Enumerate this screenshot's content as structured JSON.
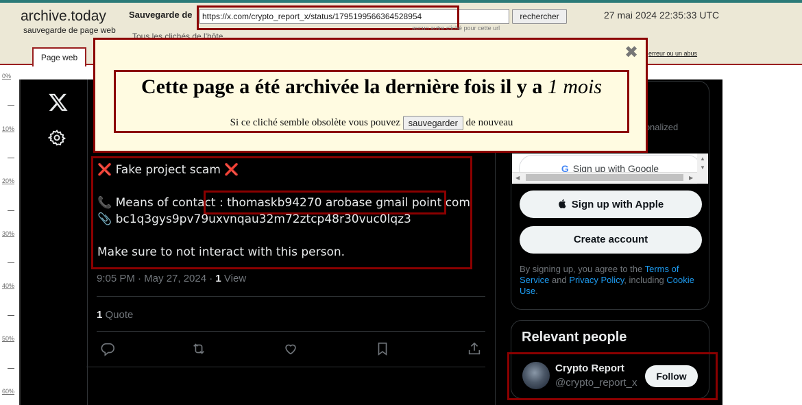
{
  "archive": {
    "brand": "archive.today",
    "brand_sub": "sauvegarde de page web",
    "save_label": "Sauvegarde de",
    "url": "https://x.com/crypto_report_x/status/1795199566364528954",
    "search_button": "rechercher",
    "no_other_snapshot": "aucun autre cliché pour cette url",
    "datetime": "27 mai 2024 22:35:33 UTC",
    "header_hint": "Tous les clichés de l'hôte",
    "report_link": "erreur ou un abus",
    "tab_label": "Page web"
  },
  "ruler": [
    "0%",
    "10%",
    "20%",
    "30%",
    "40%",
    "50%",
    "60%"
  ],
  "popup": {
    "title_main": "Cette page a été archivée la dernière fois il y a",
    "title_age": "1 mois",
    "line_before": "Si ce cliché semble obsolète vous pouvez",
    "button": "sauvegarder",
    "line_after": "de nouveau",
    "close_glyph": "✖"
  },
  "tweet": {
    "line1_cross": "❌",
    "line1_text": "Fake project scam",
    "line2_phone_icon": "📞",
    "line2_text": "Means of contact : thomaskb94270 arobase gmail point com",
    "line3_clip_icon": "📎",
    "line3_text": "bc1q3gys9pv79uxvnqau32m72ztcp48r30vuc0lqz3",
    "line4_text": "Make sure to not interact with this person.",
    "meta_time": "9:05 PM · May 27, 2024 · ",
    "views_count": "1",
    "views_label": " View",
    "quotes_count": "1",
    "quotes_label": " Quote"
  },
  "sidebar": {
    "personalized": "rsonalized",
    "google_button": "Sign up with Google",
    "apple_button": "Sign up with Apple",
    "create_account": "Create account",
    "terms_prefix": "By signing up, you agree to the ",
    "terms_link": "Terms of Service",
    "terms_and": " and ",
    "privacy_link": "Privacy Policy",
    "terms_including": ", including ",
    "cookie_link": "Cookie Use",
    "terms_end": ".",
    "relevant_title": "Relevant people",
    "person_name": "Crypto Report",
    "person_handle": "@crypto_report_x",
    "follow_button": "Follow"
  },
  "colors": {
    "highlight": "#8b0000",
    "popup_bg": "#fffbe1",
    "header_bg": "#ece8d6",
    "x_bg": "#000000",
    "x_text": "#e7e9ea",
    "x_muted": "#71767b",
    "x_link": "#1d9bf0"
  }
}
